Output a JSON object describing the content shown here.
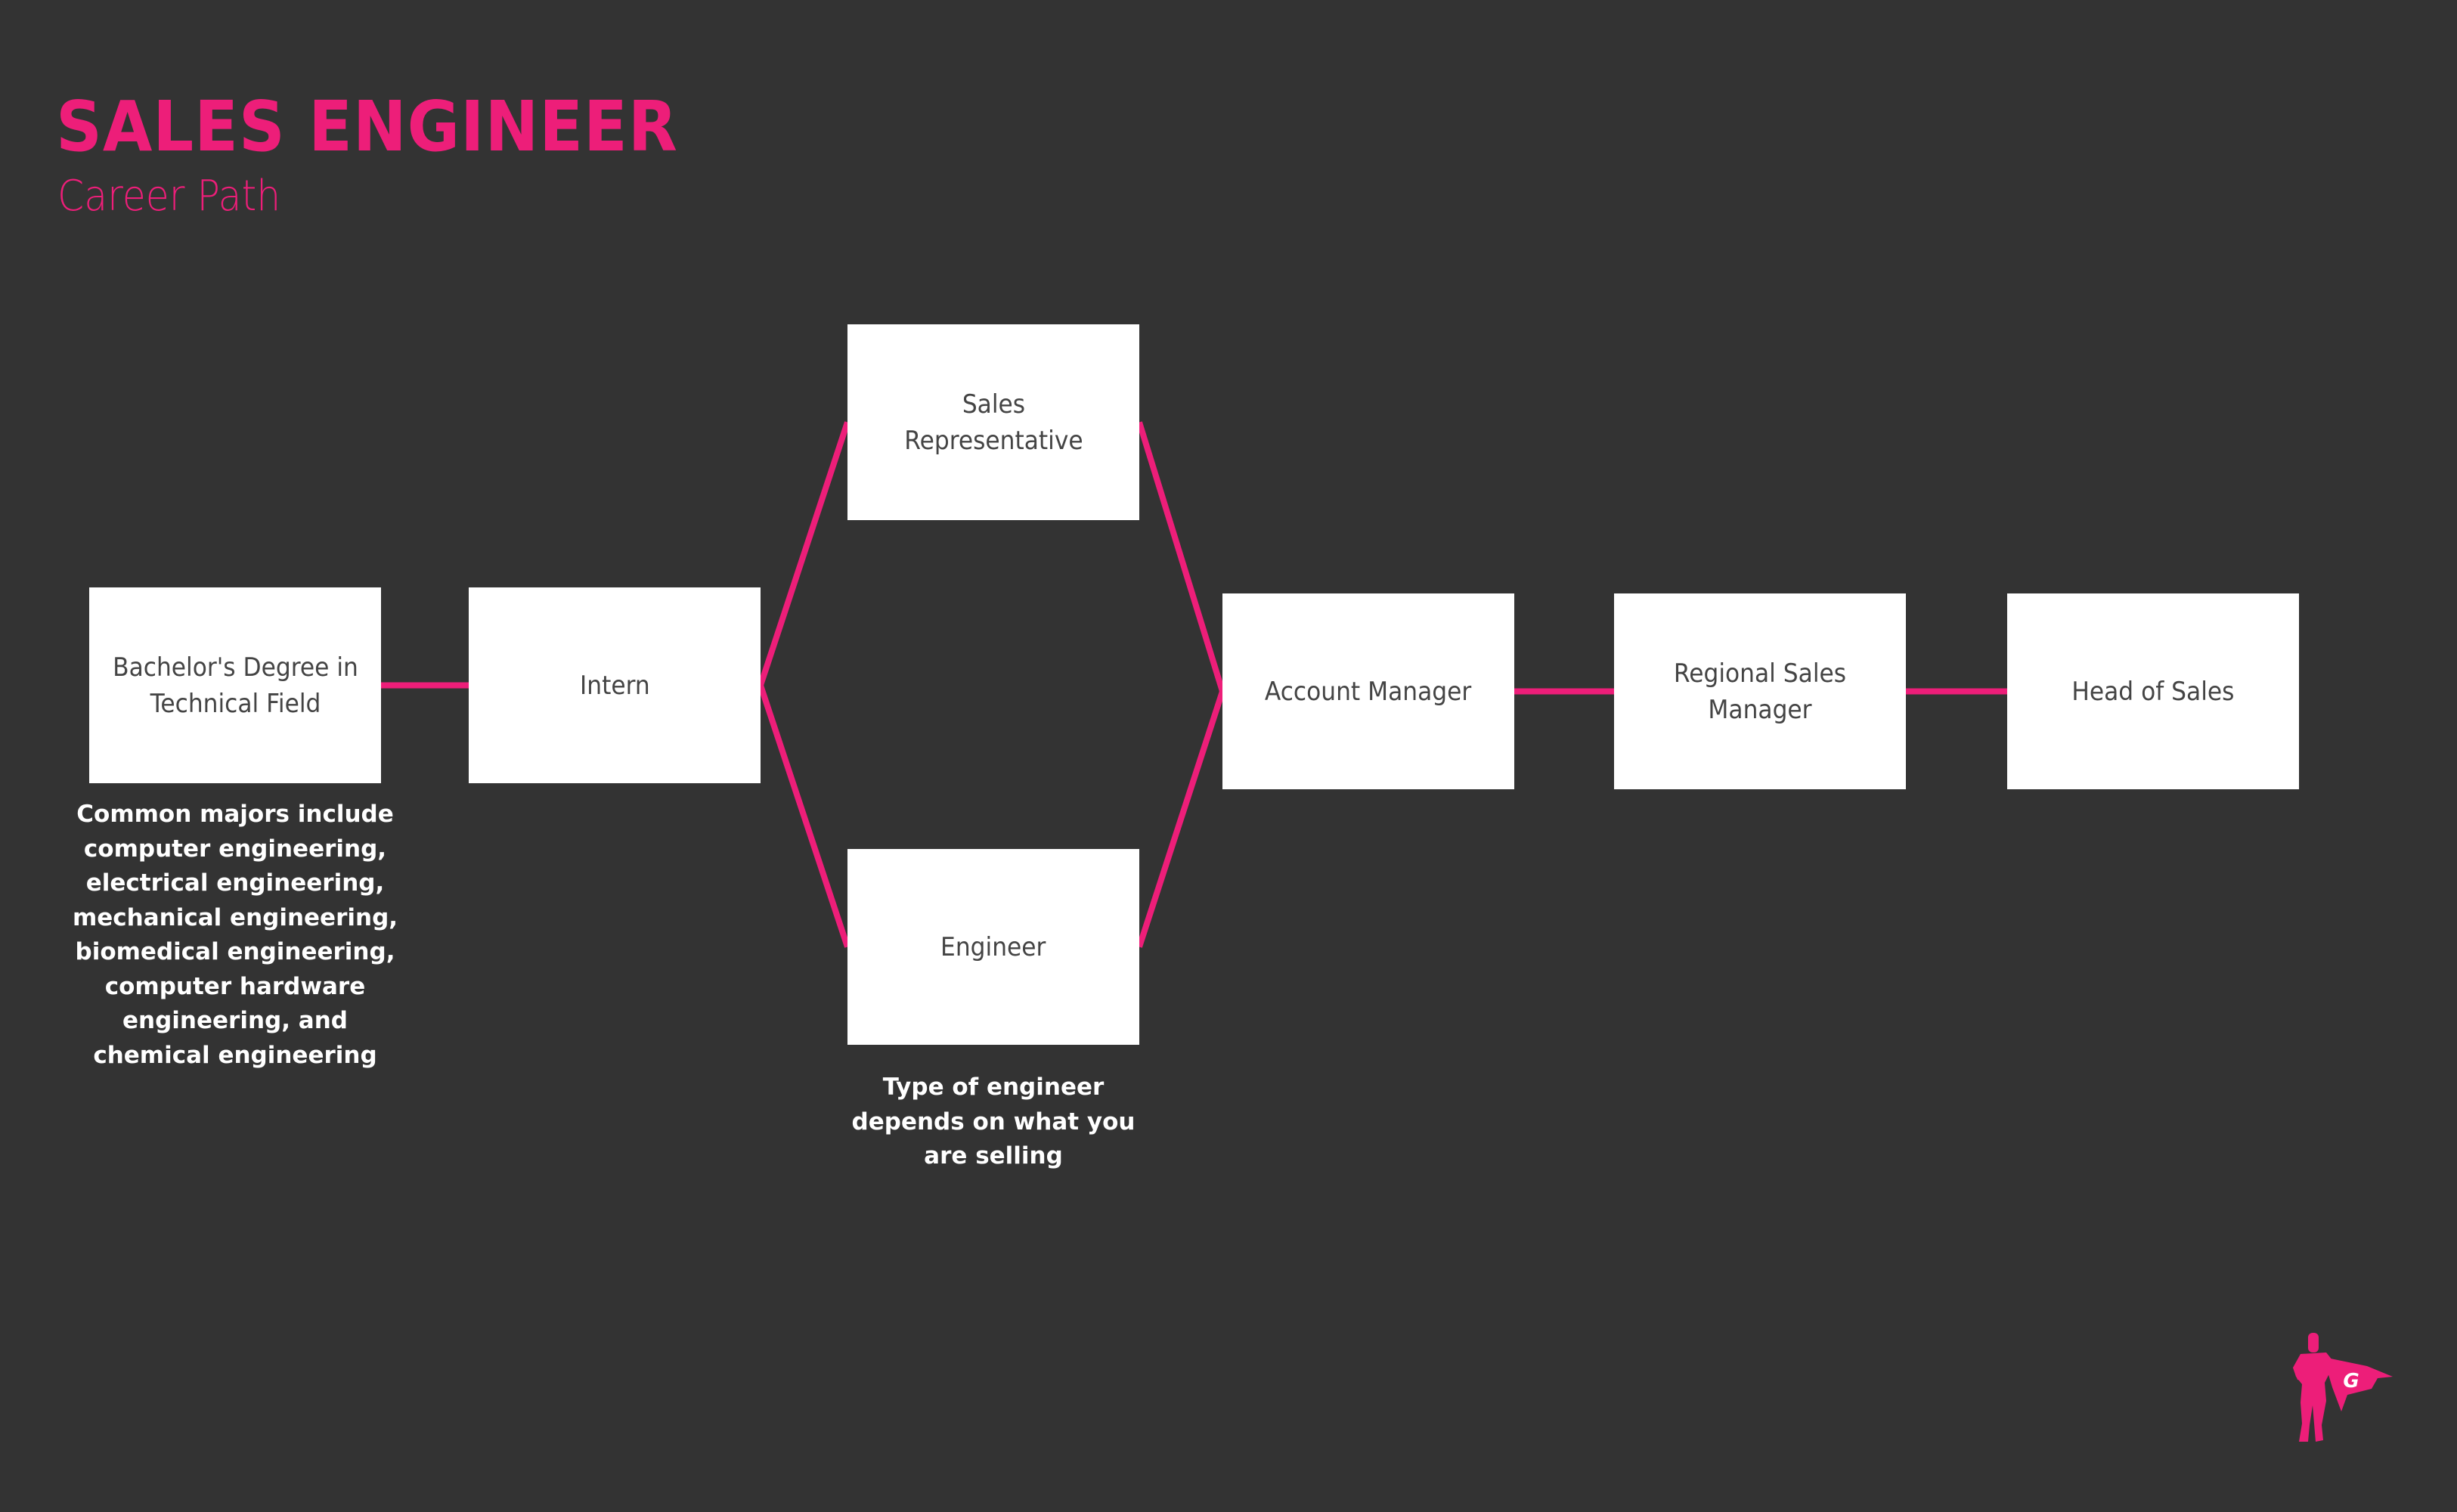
{
  "header": {
    "title": "SALES ENGINEER",
    "subtitle": "Career Path"
  },
  "colors": {
    "accent": "#ED1E79",
    "background": "#333333",
    "node_fill": "#FFFFFF",
    "node_text": "#444444",
    "note_text": "#FFFFFF"
  },
  "nodes": [
    {
      "id": "bachelors",
      "label": "Bachelor's Degree in\nTechnical Field"
    },
    {
      "id": "intern",
      "label": "Intern"
    },
    {
      "id": "sales-rep",
      "label": "Sales\nRepresentative"
    },
    {
      "id": "engineer",
      "label": "Engineer"
    },
    {
      "id": "account-manager",
      "label": "Account Manager"
    },
    {
      "id": "regional-sales-manager",
      "label": "Regional Sales\nManager"
    },
    {
      "id": "head-of-sales",
      "label": "Head of Sales"
    }
  ],
  "edges": [
    {
      "from": "bachelors",
      "to": "intern"
    },
    {
      "from": "intern",
      "to": "sales-rep"
    },
    {
      "from": "intern",
      "to": "engineer"
    },
    {
      "from": "sales-rep",
      "to": "account-manager"
    },
    {
      "from": "engineer",
      "to": "account-manager"
    },
    {
      "from": "account-manager",
      "to": "regional-sales-manager"
    },
    {
      "from": "regional-sales-manager",
      "to": "head-of-sales"
    }
  ],
  "notes": {
    "bachelors": "Common majors include\ncomputer engineering,\nelectrical engineering,\nmechanical engineering,\nbiomedical engineering,\ncomputer hardware\nengineering, and\nchemical engineering",
    "engineer": "Type of engineer\ndepends on what you\nare selling"
  },
  "logo": {
    "icon": "superhero-logo-icon",
    "letter": "G"
  }
}
